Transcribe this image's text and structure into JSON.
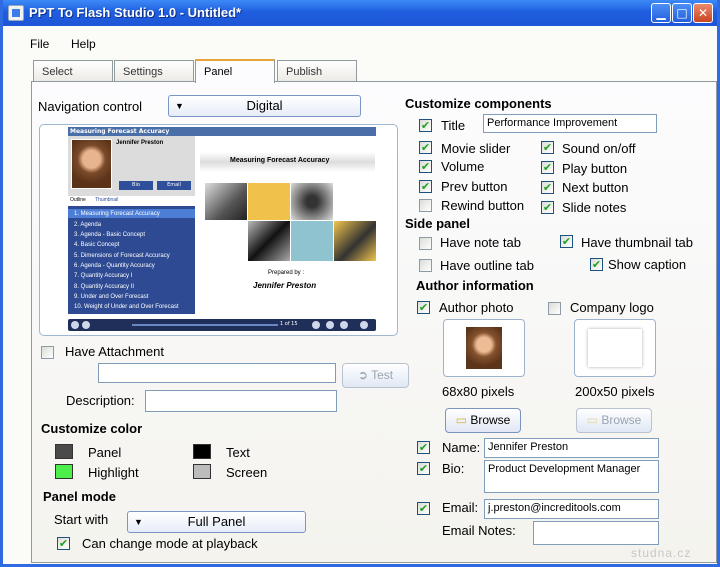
{
  "window": {
    "title": "PPT To Flash Studio 1.0 - Untitled*"
  },
  "menu": [
    "File",
    "Help"
  ],
  "tabs": [
    "Select",
    "Settings",
    "Panel",
    "Publish"
  ],
  "navigation": {
    "label": "Navigation control",
    "value": "Digital"
  },
  "preview": {
    "header": "Measuring Forecast Accuracy",
    "author_name": "Jennifer Preston",
    "bio_btn": "Bio",
    "email_btn": "Email",
    "tab_outline": "Outline",
    "tab_thumbnail": "Thumbnail",
    "items": [
      "1. Measuring Forecast Accuracy",
      "2. Agenda",
      "3. Agenda - Basic Concept",
      "4. Basic Concept",
      "5. Dimensions of Forecast Accuracy",
      "6. Agenda - Quantity Accuracy",
      "7. Quantity Accuracy I",
      "8. Quantity Accuracy II",
      "9. Under and Over Forecast",
      "10. Weight of Under and Over Forecast"
    ],
    "slide_title": "Measuring Forecast Accuracy",
    "prepared_by": "Prepared by :",
    "presenter": "Jennifer Preston",
    "page_indicator": "1 of 15"
  },
  "attachment": {
    "label": "Have Attachment",
    "checked": false,
    "path": "",
    "test_btn": "Test",
    "description_label": "Description:",
    "description": ""
  },
  "customize_color": {
    "title": "Customize color",
    "items": [
      {
        "name": "Panel",
        "color": "#4a4a4a"
      },
      {
        "name": "Text",
        "color": "#000000"
      },
      {
        "name": "Highlight",
        "color": "#4cee4c"
      },
      {
        "name": "Screen",
        "color": "#bcbcbc"
      }
    ]
  },
  "panel_mode": {
    "title": "Panel mode",
    "start_label": "Start with",
    "start_value": "Full Panel",
    "can_change": "Can change mode at playback",
    "can_change_checked": true
  },
  "components": {
    "title": "Customize components",
    "title_cb": {
      "label": "Title",
      "checked": true,
      "value": "Performance Improvement"
    },
    "left": [
      {
        "label": "Movie slider",
        "checked": true
      },
      {
        "label": "Volume",
        "checked": true
      },
      {
        "label": "Prev button",
        "checked": true
      },
      {
        "label": "Rewind button",
        "checked": false
      }
    ],
    "right": [
      {
        "label": "Sound on/off",
        "checked": true
      },
      {
        "label": "Play button",
        "checked": true
      },
      {
        "label": "Next button",
        "checked": true
      },
      {
        "label": "Slide notes",
        "checked": true
      }
    ]
  },
  "side_panel": {
    "title": "Side panel",
    "note_tab": {
      "label": "Have note tab",
      "checked": false
    },
    "thumbnail_tab": {
      "label": "Have thumbnail tab",
      "checked": true
    },
    "outline_tab": {
      "label": "Have outline tab",
      "checked": false
    },
    "caption": {
      "label": "Show caption",
      "checked": true
    }
  },
  "author": {
    "title": "Author information",
    "photo": {
      "label": "Author photo",
      "checked": true,
      "size": "68x80 pixels",
      "browse": "Browse"
    },
    "logo": {
      "label": "Company logo",
      "checked": false,
      "size": "200x50 pixels",
      "browse": "Browse"
    },
    "name": {
      "label": "Name:",
      "checked": true,
      "value": "Jennifer Preston"
    },
    "bio": {
      "label": "Bio:",
      "checked": true,
      "value": "Product Development Manager"
    },
    "email": {
      "label": "Email:",
      "checked": true,
      "value": "j.preston@increditools.com"
    },
    "email_notes": {
      "label": "Email Notes:",
      "value": ""
    }
  },
  "watermark": "studna.cz"
}
